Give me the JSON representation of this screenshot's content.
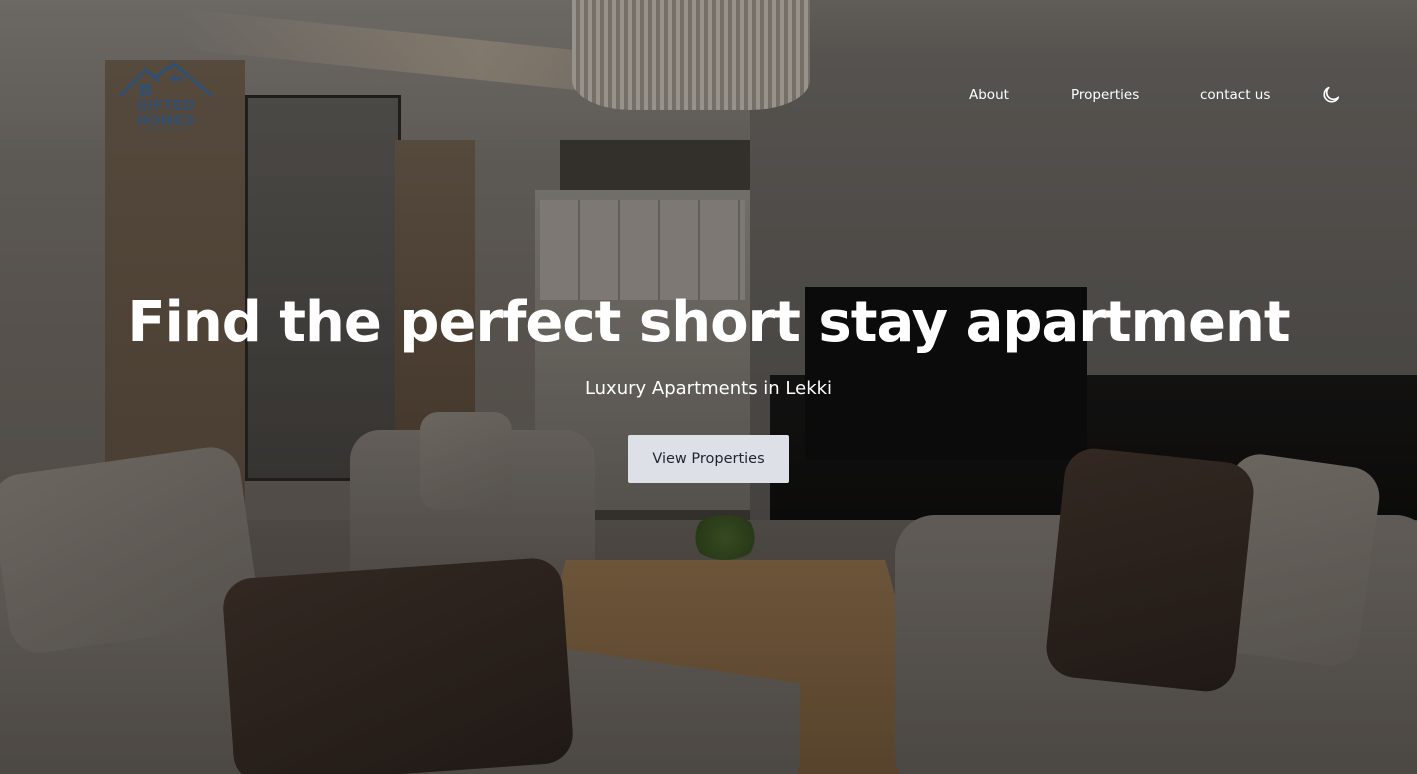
{
  "brand": {
    "logo_line1": "GIFTED",
    "logo_line2": "HOMES",
    "logo_line3": "& APARTMENTS",
    "logo_color": "#2f4f74"
  },
  "nav": {
    "items": [
      {
        "label": "About"
      },
      {
        "label": "Properties"
      },
      {
        "label": "contact us"
      }
    ],
    "theme_toggle_icon": "moon-icon"
  },
  "hero": {
    "title": "Find the perfect short stay apartment",
    "subtitle": "Luxury Apartments in Lekki",
    "cta_label": "View Properties",
    "cta_bg": "#dde0e6",
    "text_color": "#ffffff"
  }
}
